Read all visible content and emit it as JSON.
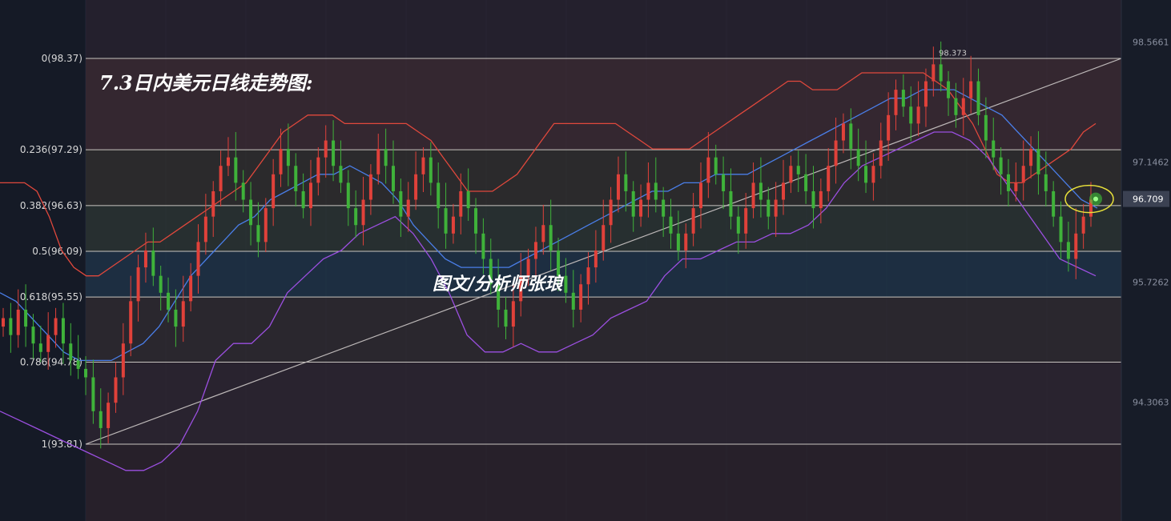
{
  "header": {
    "title": "7.3日内美元日线走势图:"
  },
  "watermark": {
    "text": "图文/分析师张琅"
  },
  "colors": {
    "background": "#151a26",
    "up_candle": "#e0413a",
    "down_candle": "#3fb23a",
    "bb_upper": "#e0483c",
    "bb_mid": "#4a7ee8",
    "bb_lower": "#9b4fe0",
    "fib_line": "#c9c5c0",
    "trend_line": "#bdb8b8",
    "highlight_ring": "#e8e03a"
  },
  "chart_data": {
    "type": "candlestick",
    "title": "7.3日内美元日线走势图:",
    "ylim": [
      93.0,
      98.9
    ],
    "fib_levels": [
      {
        "label": "0(98.37)",
        "price": 98.37
      },
      {
        "label": "0.236(97.29)",
        "price": 97.29
      },
      {
        "label": "0.382(96.63)",
        "price": 96.63
      },
      {
        "label": "0.5(96.09)",
        "price": 96.09
      },
      {
        "label": "0.618(95.55)",
        "price": 95.55
      },
      {
        "label": "0.786(94.78)",
        "price": 94.78
      },
      {
        "label": "1(93.81)",
        "price": 93.81
      }
    ],
    "right_axis_ticks": [
      {
        "label": "98.5661",
        "price": 98.566
      },
      {
        "label": "97.1462",
        "price": 97.146
      },
      {
        "label": "95.7262",
        "price": 95.726
      },
      {
        "label": "94.3063",
        "price": 94.306
      }
    ],
    "last_price": {
      "label": "96.709",
      "price": 96.709
    },
    "peak_label": {
      "label": "98.373",
      "price": 98.373
    },
    "trend_line": {
      "from_price": 93.81,
      "to_price": 98.37
    },
    "closes": [
      95.3,
      95.1,
      95.4,
      95.2,
      95.0,
      94.9,
      95.1,
      95.3,
      95.0,
      94.8,
      94.7,
      94.6,
      94.2,
      94.0,
      94.3,
      94.6,
      95.0,
      95.5,
      95.9,
      96.1,
      95.8,
      95.6,
      95.4,
      95.2,
      95.5,
      95.8,
      96.2,
      96.5,
      96.8,
      97.1,
      97.2,
      96.9,
      96.7,
      96.4,
      96.2,
      96.6,
      97.0,
      97.3,
      97.1,
      96.8,
      96.6,
      96.9,
      97.2,
      97.4,
      97.1,
      96.9,
      96.6,
      96.4,
      96.7,
      97.0,
      97.3,
      97.1,
      96.8,
      96.5,
      96.7,
      97.0,
      97.2,
      96.9,
      96.6,
      96.3,
      96.5,
      96.8,
      96.6,
      96.3,
      96.0,
      95.7,
      95.4,
      95.2,
      95.5,
      95.8,
      96.0,
      96.2,
      96.4,
      96.1,
      95.8,
      95.6,
      95.4,
      95.7,
      95.9,
      96.1,
      96.4,
      96.7,
      97.0,
      96.8,
      96.5,
      96.7,
      96.9,
      96.7,
      96.5,
      96.3,
      96.1,
      96.3,
      96.6,
      96.9,
      97.2,
      97.0,
      96.8,
      96.5,
      96.3,
      96.6,
      96.9,
      96.7,
      96.5,
      96.7,
      96.9,
      97.1,
      97.0,
      96.8,
      96.6,
      96.8,
      97.1,
      97.4,
      97.6,
      97.3,
      97.1,
      96.9,
      97.1,
      97.4,
      97.7,
      98.0,
      97.8,
      97.6,
      97.8,
      98.1,
      98.3,
      98.1,
      97.9,
      97.7,
      97.9,
      98.1,
      97.7,
      97.4,
      97.2,
      97.0,
      96.8,
      96.9,
      97.1,
      97.3,
      97.0,
      96.8,
      96.5,
      96.2,
      96.0,
      96.3,
      96.5,
      96.7
    ],
    "bb_upper": [
      96.9,
      96.9,
      96.9,
      96.8,
      96.5,
      96.1,
      95.9,
      95.8,
      95.8,
      95.9,
      96.0,
      96.1,
      96.2,
      96.2,
      96.3,
      96.4,
      96.5,
      96.6,
      96.7,
      96.8,
      96.9,
      97.1,
      97.3,
      97.5,
      97.6,
      97.7,
      97.7,
      97.7,
      97.6,
      97.6,
      97.6,
      97.6,
      97.6,
      97.6,
      97.5,
      97.4,
      97.2,
      97.0,
      96.8,
      96.8,
      96.8,
      96.9,
      97.0,
      97.2,
      97.4,
      97.6,
      97.6,
      97.6,
      97.6,
      97.6,
      97.6,
      97.5,
      97.4,
      97.3,
      97.3,
      97.3,
      97.3,
      97.4,
      97.5,
      97.6,
      97.7,
      97.8,
      97.9,
      98.0,
      98.1,
      98.1,
      98.0,
      98.0,
      98.0,
      98.1,
      98.2,
      98.2,
      98.2,
      98.2,
      98.2,
      98.2,
      98.1,
      98.0,
      97.8,
      97.6,
      97.3,
      97.0,
      96.9,
      96.9,
      97.0,
      97.1,
      97.2,
      97.3,
      97.5,
      97.6
    ],
    "bb_mid": [
      95.6,
      95.5,
      95.3,
      95.1,
      94.9,
      94.8,
      94.8,
      94.8,
      94.9,
      95.0,
      95.2,
      95.5,
      95.8,
      96.0,
      96.2,
      96.4,
      96.5,
      96.7,
      96.8,
      96.9,
      97.0,
      97.0,
      97.1,
      97.0,
      96.9,
      96.7,
      96.4,
      96.2,
      96.0,
      95.9,
      95.9,
      95.9,
      95.9,
      96.0,
      96.1,
      96.2,
      96.3,
      96.4,
      96.5,
      96.6,
      96.7,
      96.8,
      96.8,
      96.9,
      96.9,
      97.0,
      97.0,
      97.0,
      97.1,
      97.2,
      97.3,
      97.4,
      97.5,
      97.6,
      97.7,
      97.8,
      97.9,
      97.9,
      98.0,
      98.0,
      98.0,
      97.9,
      97.8,
      97.7,
      97.5,
      97.3,
      97.1,
      96.9,
      96.7,
      96.6
    ],
    "bb_lower": [
      94.2,
      94.1,
      94.0,
      93.9,
      93.8,
      93.7,
      93.6,
      93.5,
      93.5,
      93.6,
      93.8,
      94.2,
      94.8,
      95.0,
      95.0,
      95.2,
      95.6,
      95.8,
      96.0,
      96.1,
      96.3,
      96.4,
      96.5,
      96.3,
      96.0,
      95.6,
      95.1,
      94.9,
      94.9,
      95.0,
      94.9,
      94.9,
      95.0,
      95.1,
      95.3,
      95.4,
      95.5,
      95.8,
      96.0,
      96.0,
      96.1,
      96.2,
      96.2,
      96.3,
      96.3,
      96.4,
      96.6,
      96.9,
      97.1,
      97.2,
      97.3,
      97.4,
      97.5,
      97.5,
      97.4,
      97.2,
      96.9,
      96.6,
      96.3,
      96.0,
      95.9,
      95.8
    ]
  }
}
